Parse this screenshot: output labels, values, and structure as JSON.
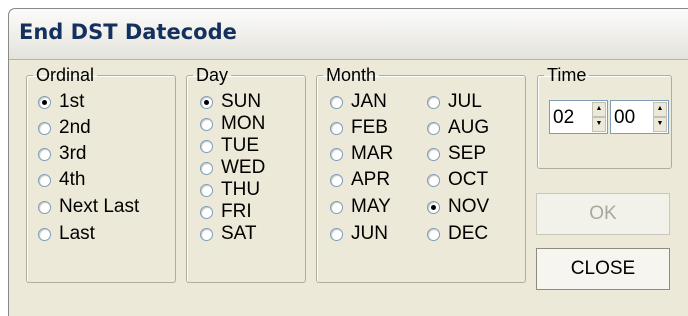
{
  "dialog": {
    "title": "End DST Datecode"
  },
  "ordinal": {
    "label": "Ordinal",
    "options": [
      "1st",
      "2nd",
      "3rd",
      "4th",
      "Next Last",
      "Last"
    ],
    "selected": "1st"
  },
  "day": {
    "label": "Day",
    "options": [
      "SUN",
      "MON",
      "TUE",
      "WED",
      "THU",
      "FRI",
      "SAT"
    ],
    "selected": "SUN"
  },
  "month": {
    "label": "Month",
    "col1": [
      "JAN",
      "FEB",
      "MAR",
      "APR",
      "MAY",
      "JUN"
    ],
    "col2": [
      "JUL",
      "AUG",
      "SEP",
      "OCT",
      "NOV",
      "DEC"
    ],
    "selected": "NOV"
  },
  "time": {
    "label": "Time",
    "hour": "02",
    "minute": "00"
  },
  "buttons": {
    "ok": "OK",
    "close": "CLOSE"
  }
}
